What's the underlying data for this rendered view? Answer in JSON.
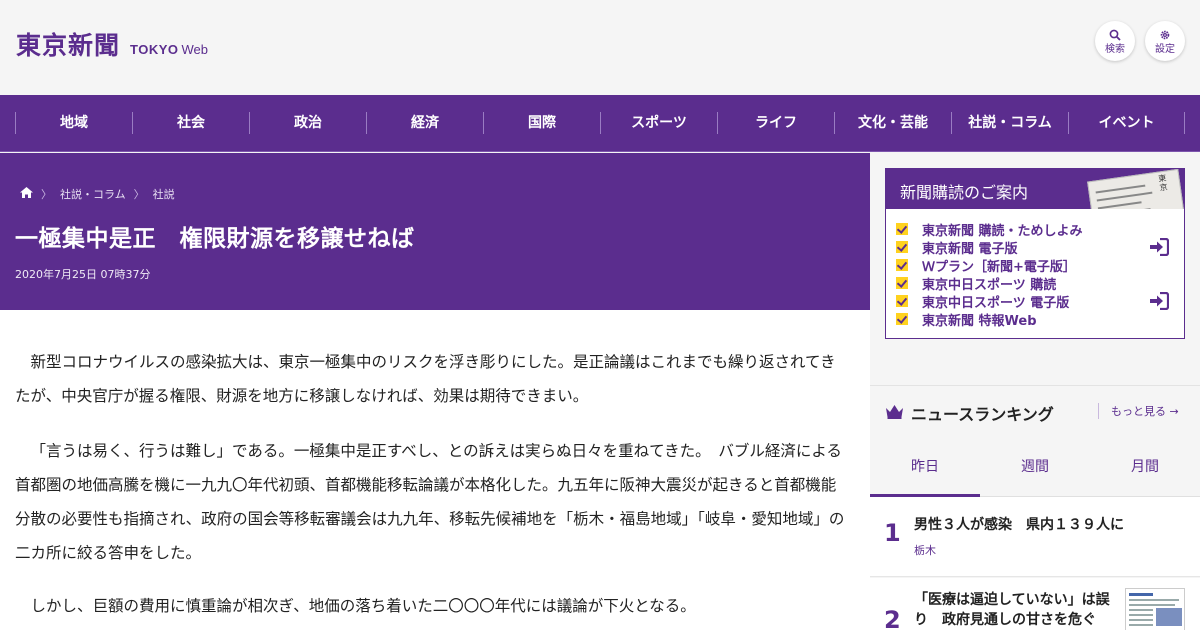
{
  "header": {
    "logo_kanji": "東京新聞",
    "logo_en_bold": "TOKYO",
    "logo_en_web": "Web",
    "search_label": "検索",
    "settings_label": "設定"
  },
  "nav": {
    "items": [
      "地域",
      "社会",
      "政治",
      "経済",
      "国際",
      "スポーツ",
      "ライフ",
      "文化・芸能",
      "社説・コラム",
      "イベント"
    ]
  },
  "breadcrumb": {
    "section": "社説・コラム",
    "subsection": "社説"
  },
  "article": {
    "title": "一極集中是正　権限財源を移譲せねば",
    "date": "2020年7月25日 07時37分",
    "paragraphs": [
      "新型コロナウイルスの感染拡大は、東京一極集中のリスクを浮き彫りにした。是正論議はこれまでも繰り返されてきたが、中央官庁が握る権限、財源を地方に移譲しなければ、効果は期待できまい。",
      "「言うは易く、行うは難し」である。一極集中是正すべし、との訴えは実らぬ日々を重ねてきた。　バブル経済による首都圏の地価高騰を機に一九九〇年代初頭、首都機能移転論議が本格化した。九五年に阪神大震災が起きると首都機能分散の必要性も指摘され、政府の国会等移転審議会は九九年、移転先候補地を「栃木・福島地域」「岐阜・愛知地域」の二カ所に絞る答申をした。",
      "しかし、巨額の費用に慎重論が相次ぎ、地価の落ち着いた二〇〇〇年代には議論が下火となる。"
    ]
  },
  "subscription": {
    "title": "新聞購読のご案内",
    "items": [
      "東京新聞 購読・ためしよみ",
      "東京新聞 電子版",
      "Ｗプラン［新聞+電子版］",
      "東京中日スポーツ 購読",
      "東京中日スポーツ 電子版",
      "東京新聞 特報Web"
    ]
  },
  "ranking": {
    "title": "ニュースランキング",
    "more_label": "もっと見る",
    "tabs": [
      "昨日",
      "週間",
      "月間"
    ],
    "active_tab": "昨日",
    "items": [
      {
        "rank": "1",
        "title": "男性３人が感染　県内１３９人に",
        "tag": "栃木"
      },
      {
        "rank": "2",
        "title": "「医療は逼迫していない」は誤り　政府見通しの甘さを危ぐ"
      }
    ]
  },
  "colors": {
    "brand": "#5b2d8e",
    "check": "#ffd21f"
  }
}
